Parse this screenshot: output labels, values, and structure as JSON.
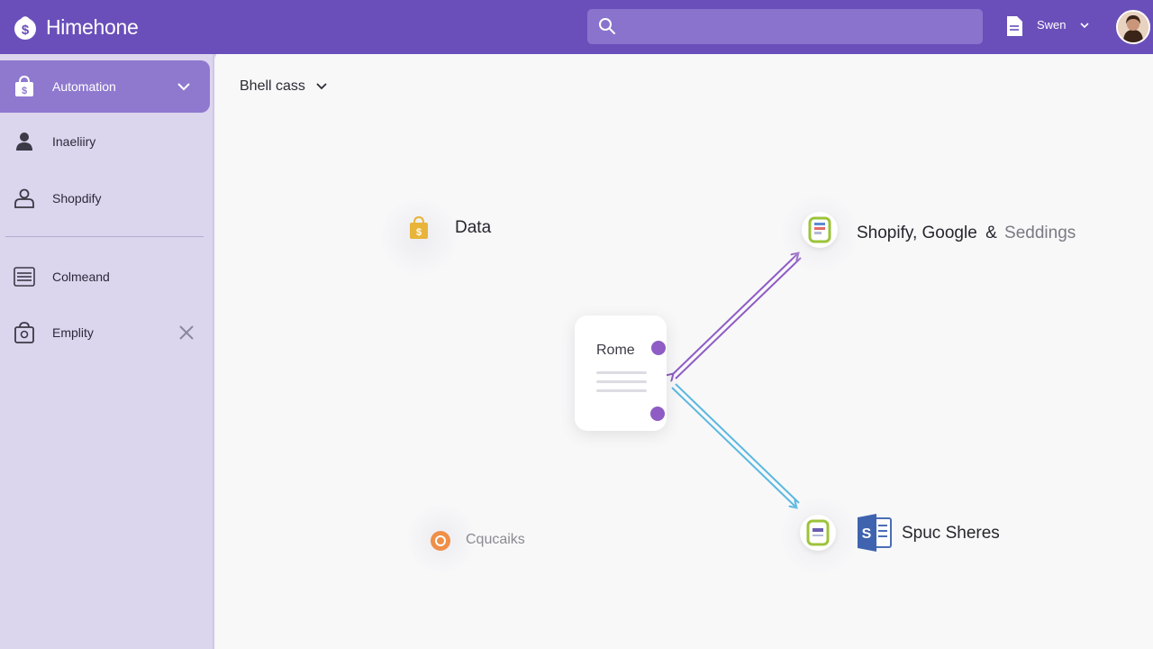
{
  "app": {
    "name": "Himehone"
  },
  "search": {
    "placeholder": "",
    "value": ""
  },
  "user_menu": {
    "label": "Swen"
  },
  "sidebar": {
    "items": [
      {
        "label": "Automation"
      },
      {
        "label": "Inaeliiry"
      },
      {
        "label": "Shopdify"
      },
      {
        "label": "Colmeand"
      },
      {
        "label": "Emplity"
      }
    ]
  },
  "main": {
    "breadcrumb": "Bhell cass",
    "nodes": {
      "data": "Data",
      "shopify_google": "Shopify, Google",
      "shopify_google_sep": "&",
      "seddings": "Seddings",
      "card_title": "Rome",
      "cqucaiks": "Cqucaiks",
      "spuc": "Spuc Sheres"
    }
  },
  "colors": {
    "header": "#6a4fba",
    "accent": "#8f79cf",
    "sidebar": "#dcd5ee",
    "wire_purple": "#8e5cc4",
    "wire_blue": "#5bb8e0"
  },
  "icons": {
    "logo": "bag-dollar-icon",
    "search": "search-icon",
    "doc": "document-icon",
    "automation": "shopping-bag-icon",
    "inaeliiry": "person-icon",
    "shopdify": "people-icon",
    "colmeand": "list-icon",
    "emplity": "bag-outline-icon"
  }
}
